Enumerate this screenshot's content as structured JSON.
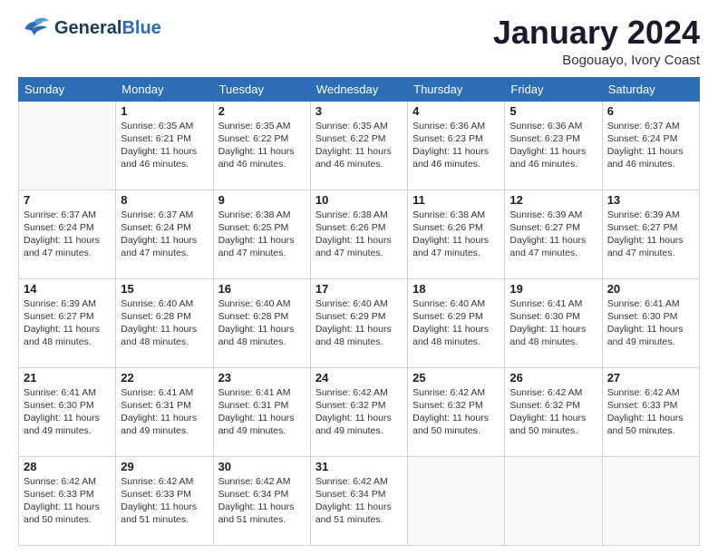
{
  "header": {
    "logo_general": "General",
    "logo_blue": "Blue",
    "main_title": "January 2024",
    "subtitle": "Bogouayo, Ivory Coast"
  },
  "days_of_week": [
    "Sunday",
    "Monday",
    "Tuesday",
    "Wednesday",
    "Thursday",
    "Friday",
    "Saturday"
  ],
  "weeks": [
    [
      {
        "day": "",
        "empty": true
      },
      {
        "day": "1",
        "sunrise": "Sunrise: 6:35 AM",
        "sunset": "Sunset: 6:21 PM",
        "daylight": "Daylight: 11 hours and 46 minutes."
      },
      {
        "day": "2",
        "sunrise": "Sunrise: 6:35 AM",
        "sunset": "Sunset: 6:22 PM",
        "daylight": "Daylight: 11 hours and 46 minutes."
      },
      {
        "day": "3",
        "sunrise": "Sunrise: 6:35 AM",
        "sunset": "Sunset: 6:22 PM",
        "daylight": "Daylight: 11 hours and 46 minutes."
      },
      {
        "day": "4",
        "sunrise": "Sunrise: 6:36 AM",
        "sunset": "Sunset: 6:23 PM",
        "daylight": "Daylight: 11 hours and 46 minutes."
      },
      {
        "day": "5",
        "sunrise": "Sunrise: 6:36 AM",
        "sunset": "Sunset: 6:23 PM",
        "daylight": "Daylight: 11 hours and 46 minutes."
      },
      {
        "day": "6",
        "sunrise": "Sunrise: 6:37 AM",
        "sunset": "Sunset: 6:24 PM",
        "daylight": "Daylight: 11 hours and 46 minutes."
      }
    ],
    [
      {
        "day": "7",
        "sunrise": "Sunrise: 6:37 AM",
        "sunset": "Sunset: 6:24 PM",
        "daylight": "Daylight: 11 hours and 47 minutes."
      },
      {
        "day": "8",
        "sunrise": "Sunrise: 6:37 AM",
        "sunset": "Sunset: 6:24 PM",
        "daylight": "Daylight: 11 hours and 47 minutes."
      },
      {
        "day": "9",
        "sunrise": "Sunrise: 6:38 AM",
        "sunset": "Sunset: 6:25 PM",
        "daylight": "Daylight: 11 hours and 47 minutes."
      },
      {
        "day": "10",
        "sunrise": "Sunrise: 6:38 AM",
        "sunset": "Sunset: 6:26 PM",
        "daylight": "Daylight: 11 hours and 47 minutes."
      },
      {
        "day": "11",
        "sunrise": "Sunrise: 6:38 AM",
        "sunset": "Sunset: 6:26 PM",
        "daylight": "Daylight: 11 hours and 47 minutes."
      },
      {
        "day": "12",
        "sunrise": "Sunrise: 6:39 AM",
        "sunset": "Sunset: 6:27 PM",
        "daylight": "Daylight: 11 hours and 47 minutes."
      },
      {
        "day": "13",
        "sunrise": "Sunrise: 6:39 AM",
        "sunset": "Sunset: 6:27 PM",
        "daylight": "Daylight: 11 hours and 47 minutes."
      }
    ],
    [
      {
        "day": "14",
        "sunrise": "Sunrise: 6:39 AM",
        "sunset": "Sunset: 6:27 PM",
        "daylight": "Daylight: 11 hours and 48 minutes."
      },
      {
        "day": "15",
        "sunrise": "Sunrise: 6:40 AM",
        "sunset": "Sunset: 6:28 PM",
        "daylight": "Daylight: 11 hours and 48 minutes."
      },
      {
        "day": "16",
        "sunrise": "Sunrise: 6:40 AM",
        "sunset": "Sunset: 6:28 PM",
        "daylight": "Daylight: 11 hours and 48 minutes."
      },
      {
        "day": "17",
        "sunrise": "Sunrise: 6:40 AM",
        "sunset": "Sunset: 6:29 PM",
        "daylight": "Daylight: 11 hours and 48 minutes."
      },
      {
        "day": "18",
        "sunrise": "Sunrise: 6:40 AM",
        "sunset": "Sunset: 6:29 PM",
        "daylight": "Daylight: 11 hours and 48 minutes."
      },
      {
        "day": "19",
        "sunrise": "Sunrise: 6:41 AM",
        "sunset": "Sunset: 6:30 PM",
        "daylight": "Daylight: 11 hours and 48 minutes."
      },
      {
        "day": "20",
        "sunrise": "Sunrise: 6:41 AM",
        "sunset": "Sunset: 6:30 PM",
        "daylight": "Daylight: 11 hours and 49 minutes."
      }
    ],
    [
      {
        "day": "21",
        "sunrise": "Sunrise: 6:41 AM",
        "sunset": "Sunset: 6:30 PM",
        "daylight": "Daylight: 11 hours and 49 minutes."
      },
      {
        "day": "22",
        "sunrise": "Sunrise: 6:41 AM",
        "sunset": "Sunset: 6:31 PM",
        "daylight": "Daylight: 11 hours and 49 minutes."
      },
      {
        "day": "23",
        "sunrise": "Sunrise: 6:41 AM",
        "sunset": "Sunset: 6:31 PM",
        "daylight": "Daylight: 11 hours and 49 minutes."
      },
      {
        "day": "24",
        "sunrise": "Sunrise: 6:42 AM",
        "sunset": "Sunset: 6:32 PM",
        "daylight": "Daylight: 11 hours and 49 minutes."
      },
      {
        "day": "25",
        "sunrise": "Sunrise: 6:42 AM",
        "sunset": "Sunset: 6:32 PM",
        "daylight": "Daylight: 11 hours and 50 minutes."
      },
      {
        "day": "26",
        "sunrise": "Sunrise: 6:42 AM",
        "sunset": "Sunset: 6:32 PM",
        "daylight": "Daylight: 11 hours and 50 minutes."
      },
      {
        "day": "27",
        "sunrise": "Sunrise: 6:42 AM",
        "sunset": "Sunset: 6:33 PM",
        "daylight": "Daylight: 11 hours and 50 minutes."
      }
    ],
    [
      {
        "day": "28",
        "sunrise": "Sunrise: 6:42 AM",
        "sunset": "Sunset: 6:33 PM",
        "daylight": "Daylight: 11 hours and 50 minutes."
      },
      {
        "day": "29",
        "sunrise": "Sunrise: 6:42 AM",
        "sunset": "Sunset: 6:33 PM",
        "daylight": "Daylight: 11 hours and 51 minutes."
      },
      {
        "day": "30",
        "sunrise": "Sunrise: 6:42 AM",
        "sunset": "Sunset: 6:34 PM",
        "daylight": "Daylight: 11 hours and 51 minutes."
      },
      {
        "day": "31",
        "sunrise": "Sunrise: 6:42 AM",
        "sunset": "Sunset: 6:34 PM",
        "daylight": "Daylight: 11 hours and 51 minutes."
      },
      {
        "day": "",
        "empty": true
      },
      {
        "day": "",
        "empty": true
      },
      {
        "day": "",
        "empty": true
      }
    ]
  ]
}
